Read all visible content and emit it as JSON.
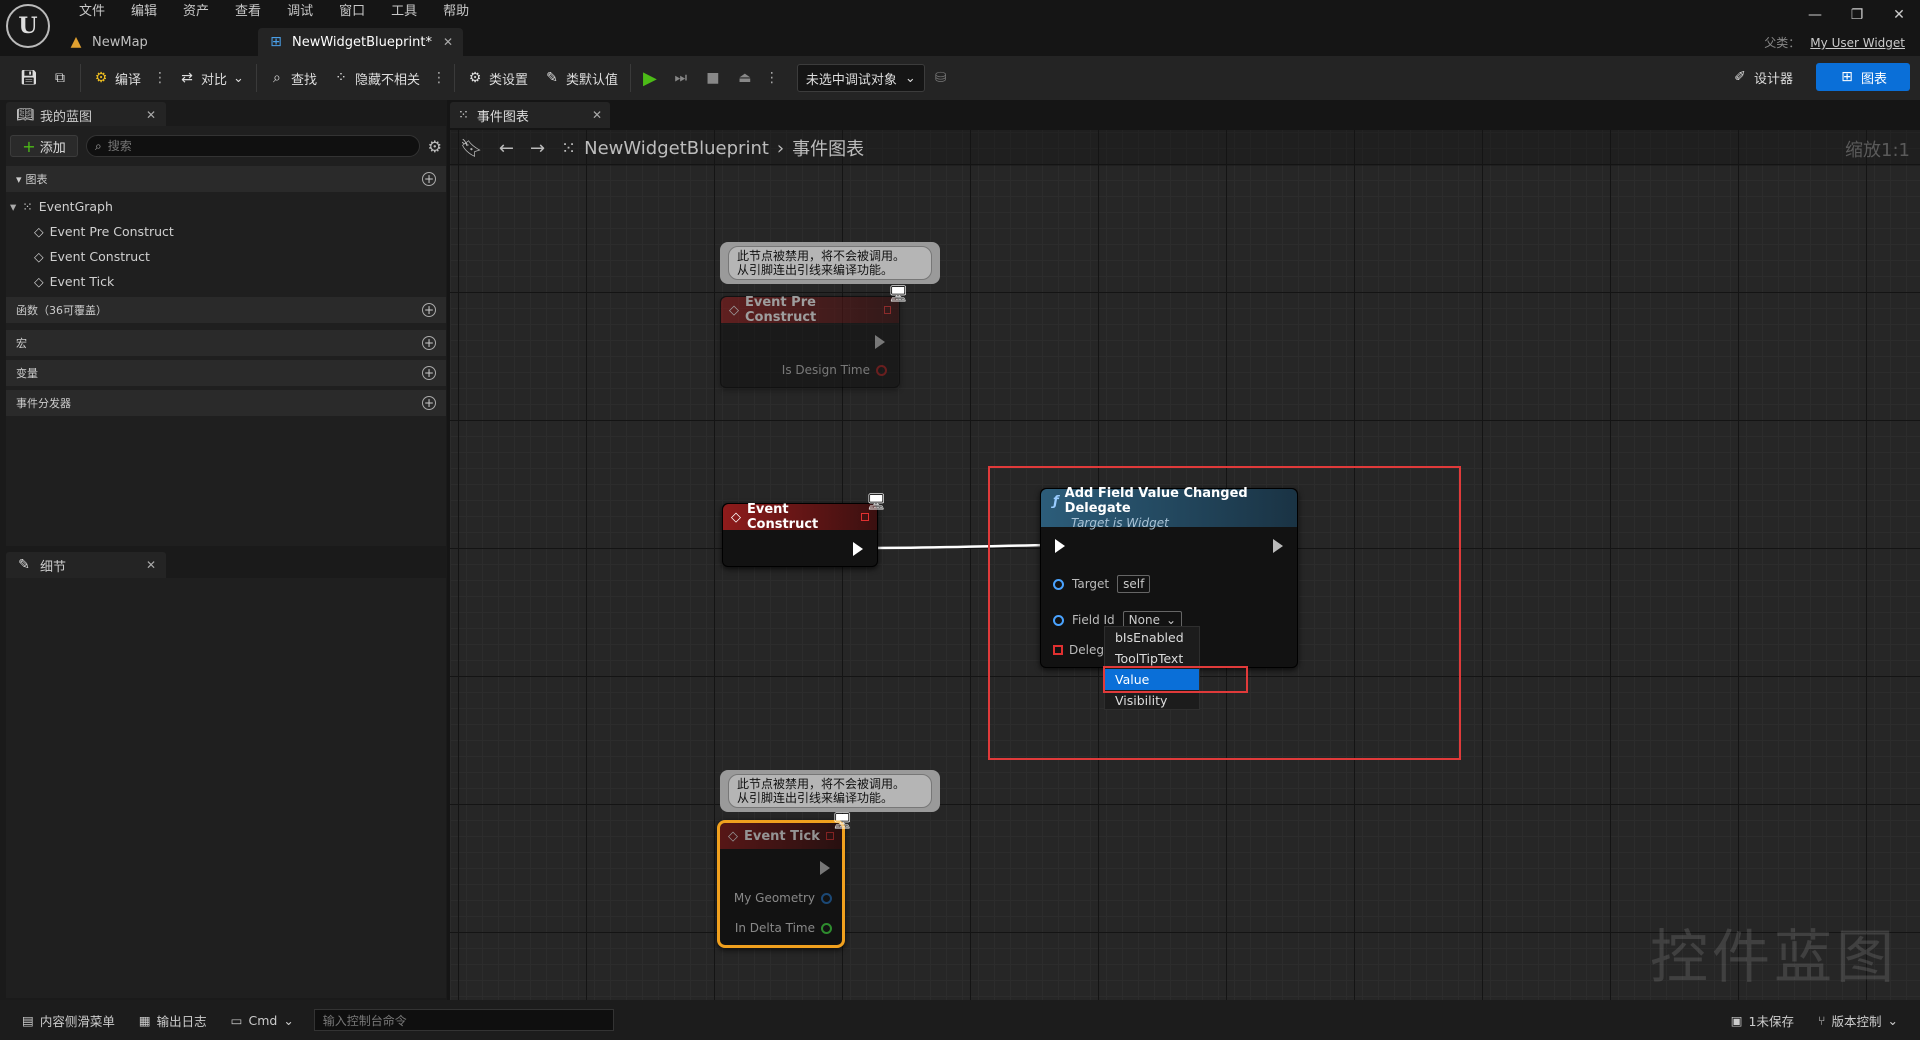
{
  "menu": [
    "文件",
    "编辑",
    "资产",
    "查看",
    "调试",
    "窗口",
    "工具",
    "帮助"
  ],
  "doc_tabs": [
    {
      "label": "NewMap"
    },
    {
      "label": "NewWidgetBlueprint*"
    }
  ],
  "parent_class": {
    "label": "父类：",
    "value": "My User Widget"
  },
  "toolbar": {
    "compile": "编译",
    "diff": "对比",
    "find": "查找",
    "hide_unrelated": "隐藏不相关",
    "class_settings": "类设置",
    "class_defaults": "类默认值",
    "debug_select": "未选中调试对象",
    "designer": "设计器",
    "graph": "图表"
  },
  "my_blueprint": {
    "tab": "我的蓝图",
    "add": "添加",
    "search_placeholder": "搜索",
    "sections": {
      "graphs": "图表",
      "functions": "函数（36可覆盖）",
      "macros": "宏",
      "variables": "变量",
      "dispatchers": "事件分发器"
    },
    "event_graph": "EventGraph",
    "events": [
      "Event Pre Construct",
      "Event Construct",
      "Event Tick"
    ]
  },
  "details": {
    "tab": "细节"
  },
  "graph": {
    "tab": "事件图表",
    "breadcrumb": [
      "NewWidgetBlueprint",
      "事件图表"
    ],
    "zoom": "缩放1:1",
    "watermark": "控件蓝图"
  },
  "nodes": {
    "disabled_comment_line1": "此节点被禁用，将不会被调用。",
    "disabled_comment_line2": "从引脚连出引线来编译功能。",
    "pre_construct": {
      "title": "Event Pre Construct",
      "pin": "Is Design Time"
    },
    "construct": {
      "title": "Event Construct"
    },
    "tick": {
      "title": "Event Tick",
      "pins": [
        "My Geometry",
        "In Delta Time"
      ]
    },
    "add_delegate": {
      "title": "Add Field Value Changed Delegate",
      "subtitle": "Target is Widget",
      "target_label": "Target",
      "target_value": "self",
      "field_label": "Field Id",
      "field_value": "None",
      "delegate_label": "Delegate",
      "options": [
        "bIsEnabled",
        "ToolTipText",
        "Value",
        "Visibility"
      ],
      "selected_option": "Value"
    }
  },
  "statusbar": {
    "content_drawer": "内容侧滑菜单",
    "output_log": "输出日志",
    "cmd": "Cmd",
    "console_placeholder": "输入控制台命令",
    "unsaved": "1未保存",
    "source_control": "版本控制"
  },
  "colors": {
    "accent": "#0a6fd8",
    "highlight_box": "#e03a3a",
    "event_header": "#8f1b1b",
    "function_header": "#2c5d7a"
  }
}
